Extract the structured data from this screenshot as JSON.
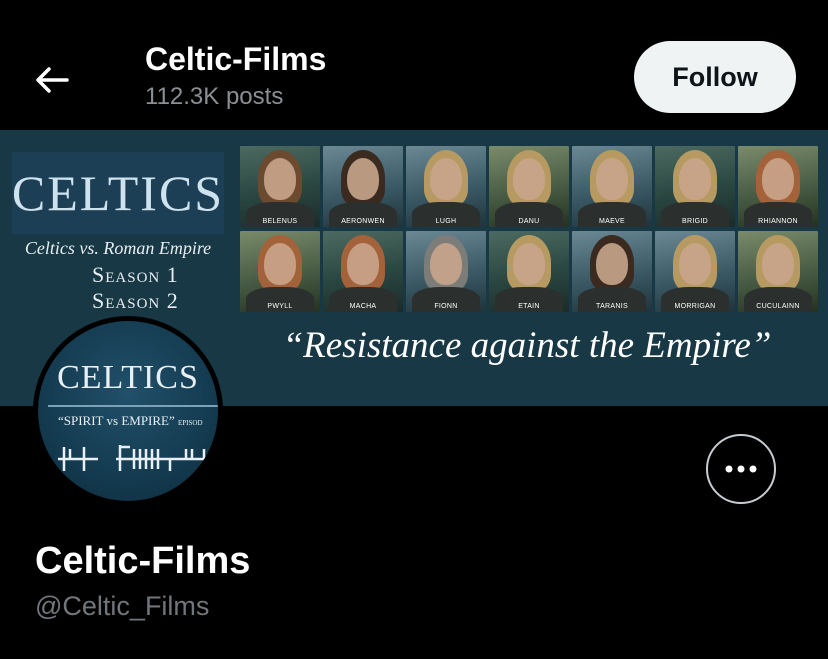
{
  "header": {
    "display_name": "Celtic-Films",
    "posts_count": "112.3K posts",
    "follow_label": "Follow"
  },
  "banner": {
    "title": "CELTICS",
    "subtitle": "Celtics vs. Roman Empire",
    "season_1": "Season 1",
    "season_2": "Season 2",
    "tagline": "“Resistance against the Empire”",
    "characters": [
      "BELENUS",
      "AERONWEN",
      "LUGH",
      "DANU",
      "MAEVE",
      "BRIGID",
      "RHIANNON",
      "PWYLL",
      "MACHA",
      "FIONN",
      "ETAIN",
      "TARANIS",
      "MORRIGAN",
      "CUCULAINN"
    ]
  },
  "avatar": {
    "title": "CELTICS",
    "subtitle": "“SPIRIT vs EMPIRE”",
    "subtitle_small": "EPISOD"
  },
  "profile": {
    "name": "Celtic-Films",
    "handle": "@Celtic_Films"
  },
  "icons": {
    "back": "back-arrow-icon",
    "more": "more-horizontal-icon"
  },
  "colors": {
    "background": "#000000",
    "follow_button_bg": "#eff3f4",
    "banner_bg": "#173844",
    "secondary_text": "#71767b"
  }
}
